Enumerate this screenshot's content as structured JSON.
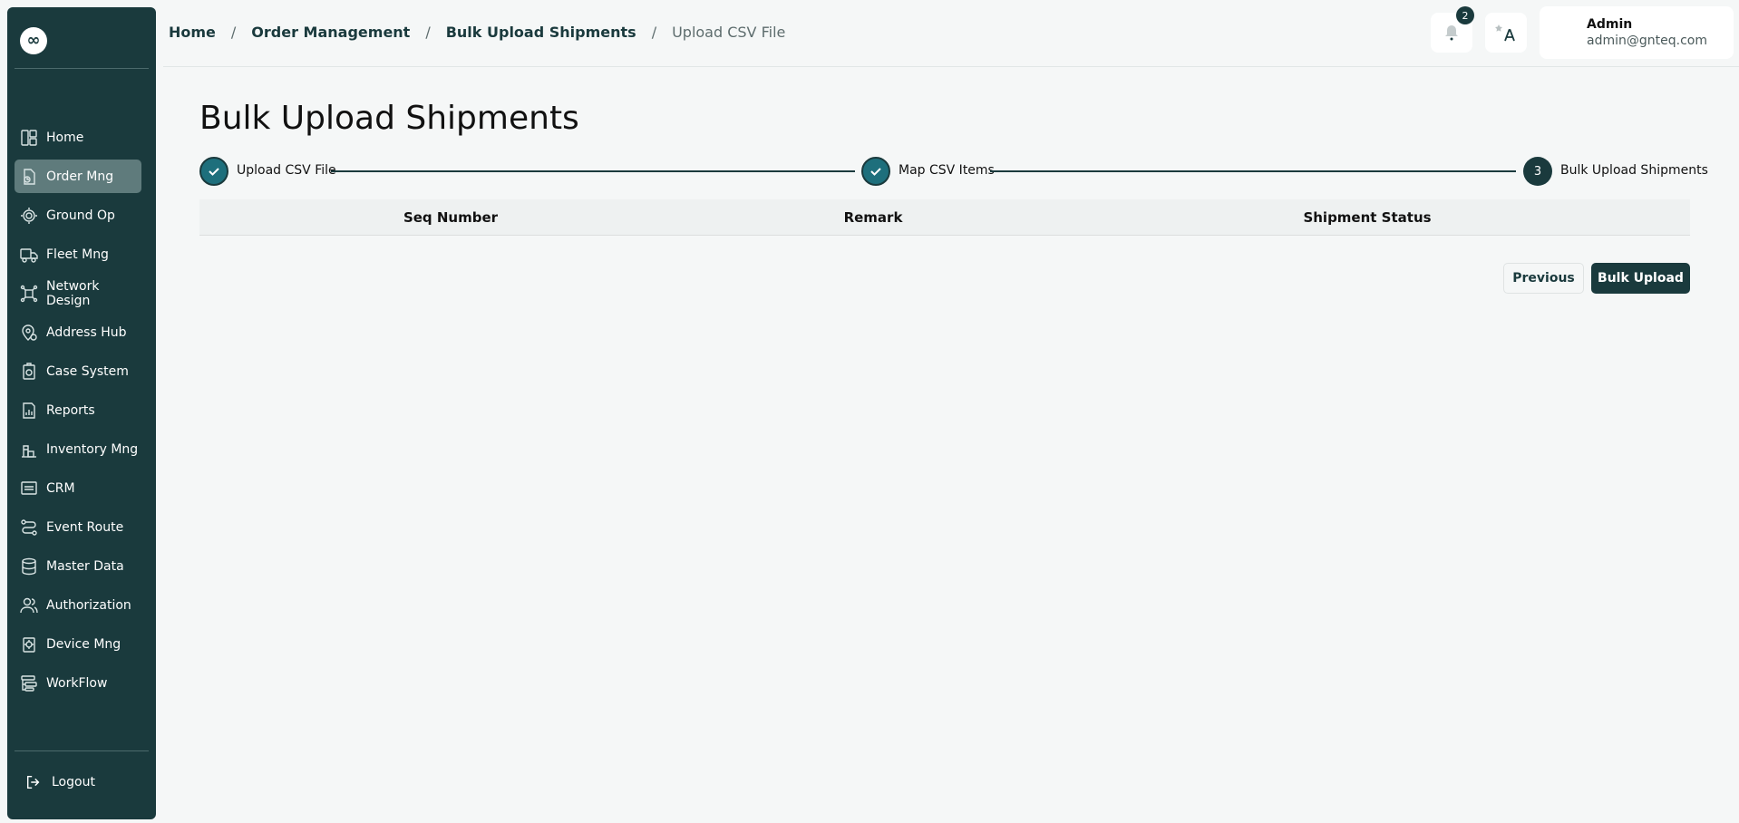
{
  "sidebar": {
    "logo": "∞",
    "items": [
      {
        "label": "Home",
        "icon": "home-icon"
      },
      {
        "label": "Order Mng",
        "icon": "order-icon",
        "active": true
      },
      {
        "label": "Ground Op",
        "icon": "ground-op-icon"
      },
      {
        "label": "Fleet Mng",
        "icon": "truck-icon"
      },
      {
        "label": "Network Design",
        "icon": "network-icon"
      },
      {
        "label": "Address Hub",
        "icon": "map-pin-icon"
      },
      {
        "label": "Case System",
        "icon": "case-icon"
      },
      {
        "label": "Reports",
        "icon": "report-icon"
      },
      {
        "label": "Inventory Mng",
        "icon": "inventory-icon"
      },
      {
        "label": "CRM",
        "icon": "crm-icon"
      },
      {
        "label": "Event Route",
        "icon": "route-icon"
      },
      {
        "label": "Master Data",
        "icon": "database-icon"
      },
      {
        "label": "Authorization",
        "icon": "users-icon"
      },
      {
        "label": "Device Mng",
        "icon": "device-icon"
      },
      {
        "label": "WorkFlow",
        "icon": "workflow-icon"
      }
    ],
    "logout": "Logout"
  },
  "header": {
    "breadcrumb": [
      "Home",
      "Order Management",
      "Bulk Upload Shipments",
      "Upload CSV File"
    ],
    "notification_count": "2",
    "user_name": "Admin",
    "user_email": "admin@gnteq.com"
  },
  "main": {
    "title": "Bulk Upload Shipments",
    "steps": [
      {
        "label": "Upload CSV File",
        "status": "done"
      },
      {
        "label": "Map CSV Items",
        "status": "done"
      },
      {
        "number": "3",
        "label": "Bulk Upload Shipments",
        "status": "current"
      }
    ],
    "table_columns": [
      "Seq Number",
      "Remark",
      "Shipment Status"
    ],
    "buttons": {
      "previous": "Previous",
      "bulk_upload": "Bulk Upload"
    }
  },
  "colors": {
    "sidebar_bg": "#1a3a3d",
    "accent": "#1e6f7c",
    "page_bg": "#f5f7f7"
  }
}
